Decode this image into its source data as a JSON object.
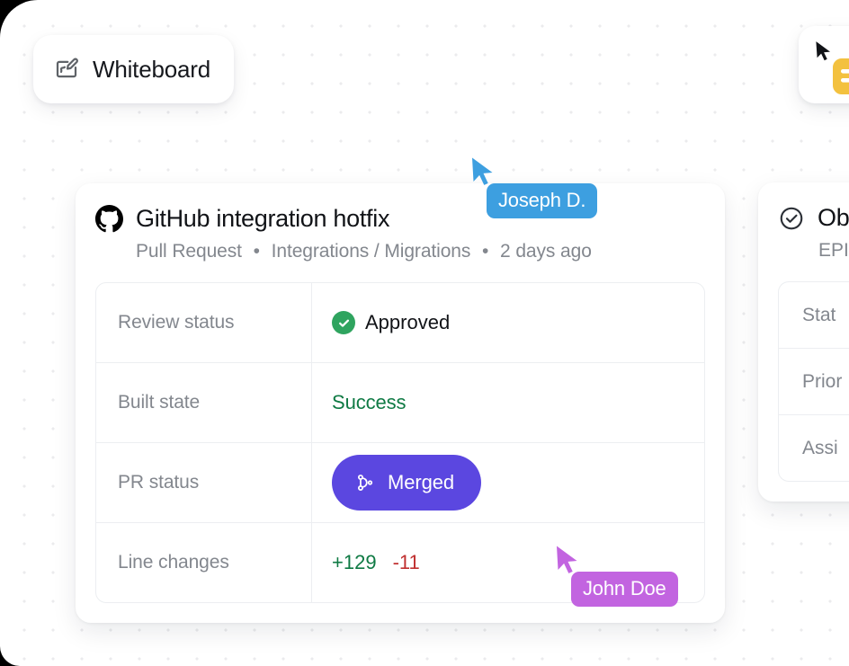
{
  "board": {
    "background_color": "#ffffff",
    "dot_color": "#ebebed"
  },
  "whiteboard_chip": {
    "label": "Whiteboard",
    "icon": "whiteboard-pen-icon"
  },
  "note_card": {
    "cursor_icon": "cursor-arrow-icon",
    "sticky_icon": "sticky-note-icon",
    "sticky_color": "#f5c242"
  },
  "pr_card": {
    "provider_icon": "github-icon",
    "title": "GitHub integration hotfix",
    "meta": {
      "type": "Pull Request",
      "project": "Integrations / Migrations",
      "updated": "2 days ago",
      "separator": "•"
    },
    "rows": [
      {
        "key": "Review status",
        "value": "Approved",
        "kind": "badge-check",
        "icon": "check-circle-icon",
        "color": "#2fa45f"
      },
      {
        "key": "Built state",
        "value": "Success",
        "kind": "text",
        "color": "#0f7a44"
      },
      {
        "key": "PR status",
        "value": "Merged",
        "kind": "button",
        "icon": "git-merge-icon",
        "color": "#5b47e0"
      },
      {
        "key": "Line changes",
        "kind": "diff",
        "additions": "+129",
        "deletions": "-11",
        "additions_color": "#0f7a44",
        "deletions_color": "#c03030"
      }
    ]
  },
  "object_card": {
    "status_icon": "check-circle-outline-icon",
    "title": "Ob",
    "subtitle": "EPI",
    "rows": [
      "Stat",
      "Prior",
      "Assi"
    ]
  },
  "cursors": [
    {
      "name": "Joseph D.",
      "color": "#3d9fe0",
      "arrow_color": "#3d9fe0"
    },
    {
      "name": "John Doe",
      "color": "#c264e0",
      "arrow_color": "#c264e0"
    }
  ]
}
